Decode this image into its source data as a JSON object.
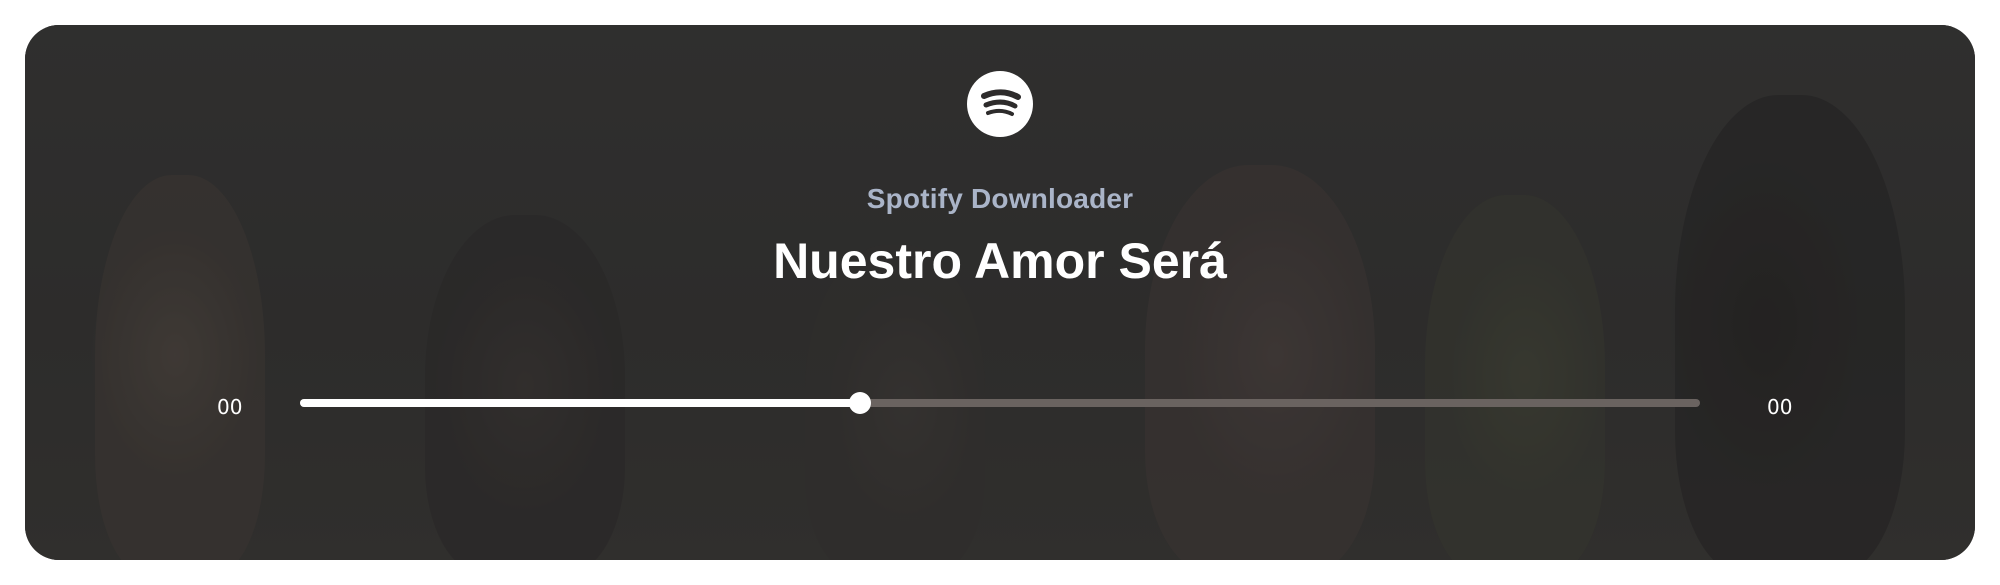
{
  "player": {
    "logo_icon": "spotify-icon",
    "app_name": "Spotify Downloader",
    "track_title": "Nuestro Amor Será",
    "elapsed_time": "00",
    "total_time": "00",
    "progress_fraction": 0.4,
    "colors": {
      "app_name": "#aab4c8",
      "track_title": "#ffffff",
      "progress_track": "#6a6360",
      "progress_fill": "#ffffff"
    }
  }
}
